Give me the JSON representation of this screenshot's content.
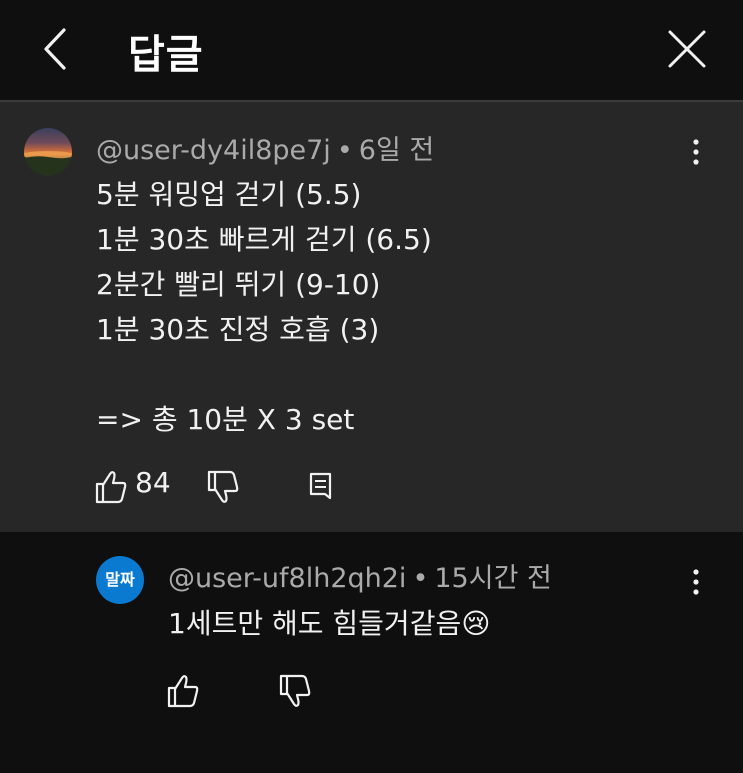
{
  "header": {
    "title": "답글",
    "back_icon": "chevron-left-icon",
    "close_icon": "close-icon"
  },
  "parent_comment": {
    "author": "@user-dy4il8pe7j",
    "separator": "•",
    "time": "6일 전",
    "lines": [
      "5분 워밍업 걷기 (5.5)",
      "1분 30초 빠르게 걷기 (6.5)",
      "2분간 빨리 뛰기 (9-10)",
      "1분 30초 진정 호흡 (3)",
      "",
      "=> 총 10분 X 3 set"
    ],
    "like_count": "84",
    "icons": [
      "like-icon",
      "dislike-icon",
      "reply-icon",
      "more-icon"
    ]
  },
  "reply": {
    "avatar_text": "말짜",
    "author": "@user-uf8lh2qh2i",
    "separator": "•",
    "time": "15시간 전",
    "text": "1세트만 해도 힘들거같음",
    "emoji": "😢",
    "icons": [
      "like-icon",
      "dislike-icon",
      "more-icon"
    ]
  },
  "colors": {
    "background": "#0f0f0f",
    "parent_background": "#272727",
    "meta_text": "#aaaaaa",
    "primary_text": "#f1f1f1",
    "reply_avatar": "#0a7ad0"
  }
}
